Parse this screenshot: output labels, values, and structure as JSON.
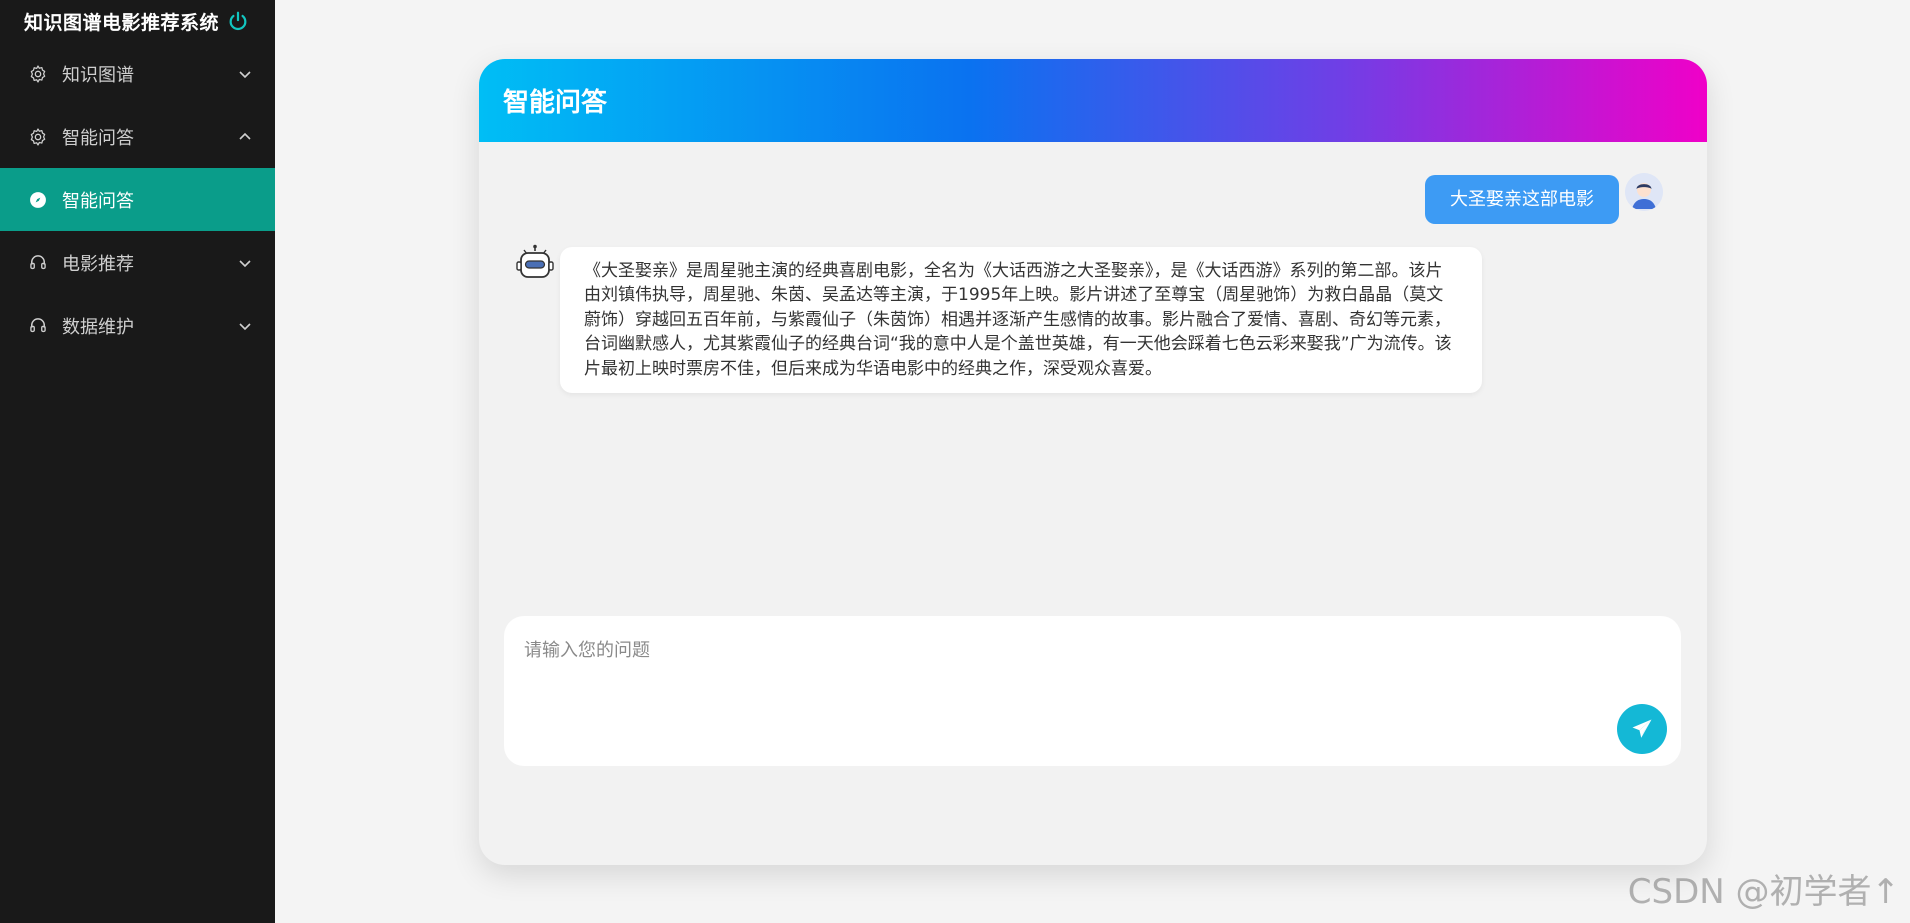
{
  "sidebar": {
    "title": "知识图谱电影推荐系统",
    "items": [
      {
        "label": "知识图谱",
        "icon": "gear-icon",
        "chevron": "chevron-down-icon"
      },
      {
        "label": "智能问答",
        "icon": "gear-icon",
        "chevron": "chevron-up-icon"
      },
      {
        "label": "智能问答",
        "icon": "compass-icon",
        "active": true
      },
      {
        "label": "电影推荐",
        "icon": "headset-icon",
        "chevron": "chevron-down-icon"
      },
      {
        "label": "数据维护",
        "icon": "headset-icon",
        "chevron": "chevron-down-icon"
      }
    ],
    "active_color": "#0a9d8a"
  },
  "chat": {
    "title": "智能问答",
    "user_message": "大圣娶亲这部电影",
    "bot_message": "《大圣娶亲》是周星驰主演的经典喜剧电影，全名为《大话西游之大圣娶亲》，是《大话西游》系列的第二部。该片由刘镇伟执导，周星驰、朱茵、吴孟达等主演，于1995年上映。影片讲述了至尊宝（周星驰饰）为救白晶晶（莫文蔚饰）穿越回五百年前，与紫霞仙子（朱茵饰）相遇并逐渐产生感情的故事。影片融合了爱情、喜剧、奇幻等元素，台词幽默感人，尤其紫霞仙子的经典台词“我的意中人是个盖世英雄，有一天他会踩着七色云彩来娶我”广为流传。该片最初上映时票房不佳，但后来成为华语电影中的经典之作，深受观众喜爱。",
    "input_placeholder": "请输入您的问题",
    "user_bubble_color": "#3d9bf4",
    "send_button_color": "#14b8d6"
  },
  "watermark": "CSDN @初学者↑"
}
